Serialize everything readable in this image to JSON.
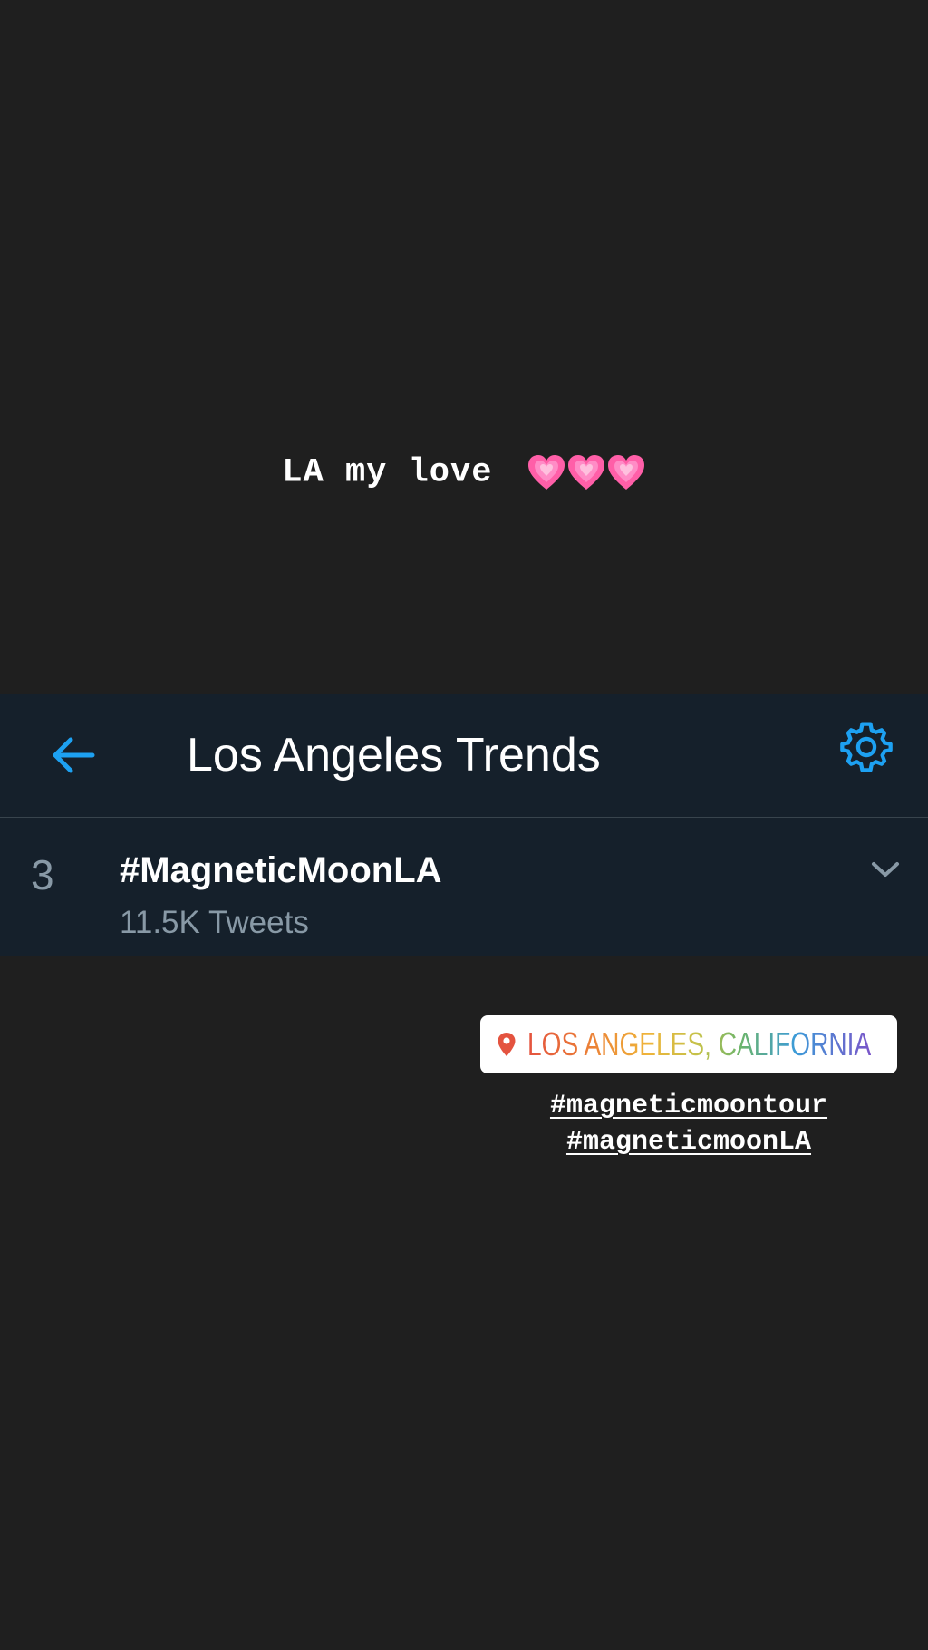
{
  "story": {
    "caption": "LA my love",
    "emoji": [
      "growing-heart",
      "growing-heart",
      "growing-heart"
    ]
  },
  "twitter": {
    "header": {
      "title": "Los Angeles Trends",
      "back_icon": "arrow-left-icon",
      "settings_icon": "gear-icon"
    },
    "trend": {
      "rank": "3",
      "name": "#MagneticMoonLA",
      "count": "11.5K Tweets"
    },
    "colors": {
      "panel_bg": "#15202b",
      "accent": "#1da1f2",
      "muted": "#8899a6"
    }
  },
  "location_sticker": {
    "text": "LOS ANGELES, CALIFORNIA",
    "icon": "map-pin-icon"
  },
  "hashtags": [
    "#magneticmoontour",
    "#magneticmoonLA"
  ],
  "colors": {
    "background": "#1f1f1f",
    "heart": "#ff6fb5"
  }
}
